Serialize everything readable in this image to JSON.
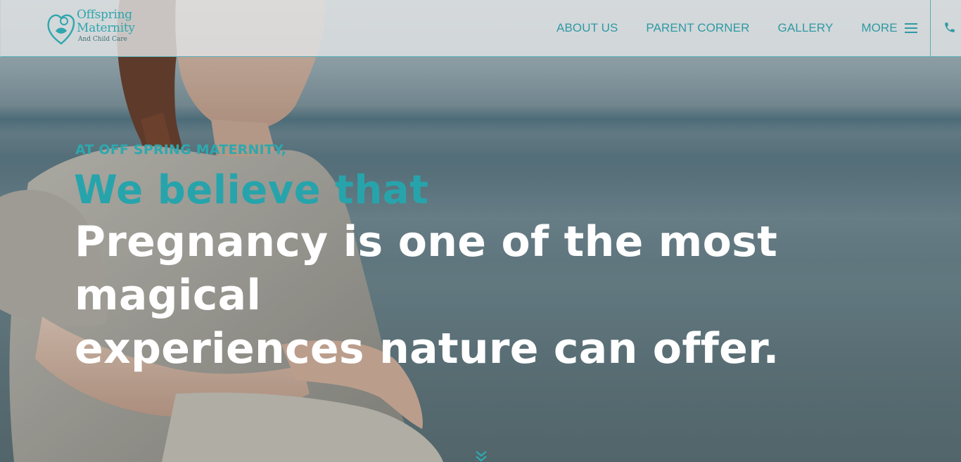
{
  "header": {
    "logo": {
      "line1": "Offspring",
      "line2": "Maternity",
      "line3": "And Child Care"
    },
    "nav": [
      {
        "label": "ABOUT US"
      },
      {
        "label": "PARENT CORNER"
      },
      {
        "label": "GALLERY"
      },
      {
        "label": "MORE"
      }
    ],
    "icons": {
      "menu": "hamburger-icon",
      "phone": "phone-icon"
    }
  },
  "hero": {
    "eyebrow": "AT OFF SPRING MATERNITY,",
    "believe": "We believe that",
    "headline_line1": "Pregnancy is one of the most magical",
    "headline_line2": "experiences nature can offer.",
    "scroll_icon": "double-chevron-down-icon"
  },
  "colors": {
    "accent": "#2e9aa3",
    "headline": "#ffffff",
    "header_bg": "#e1e3e4"
  }
}
